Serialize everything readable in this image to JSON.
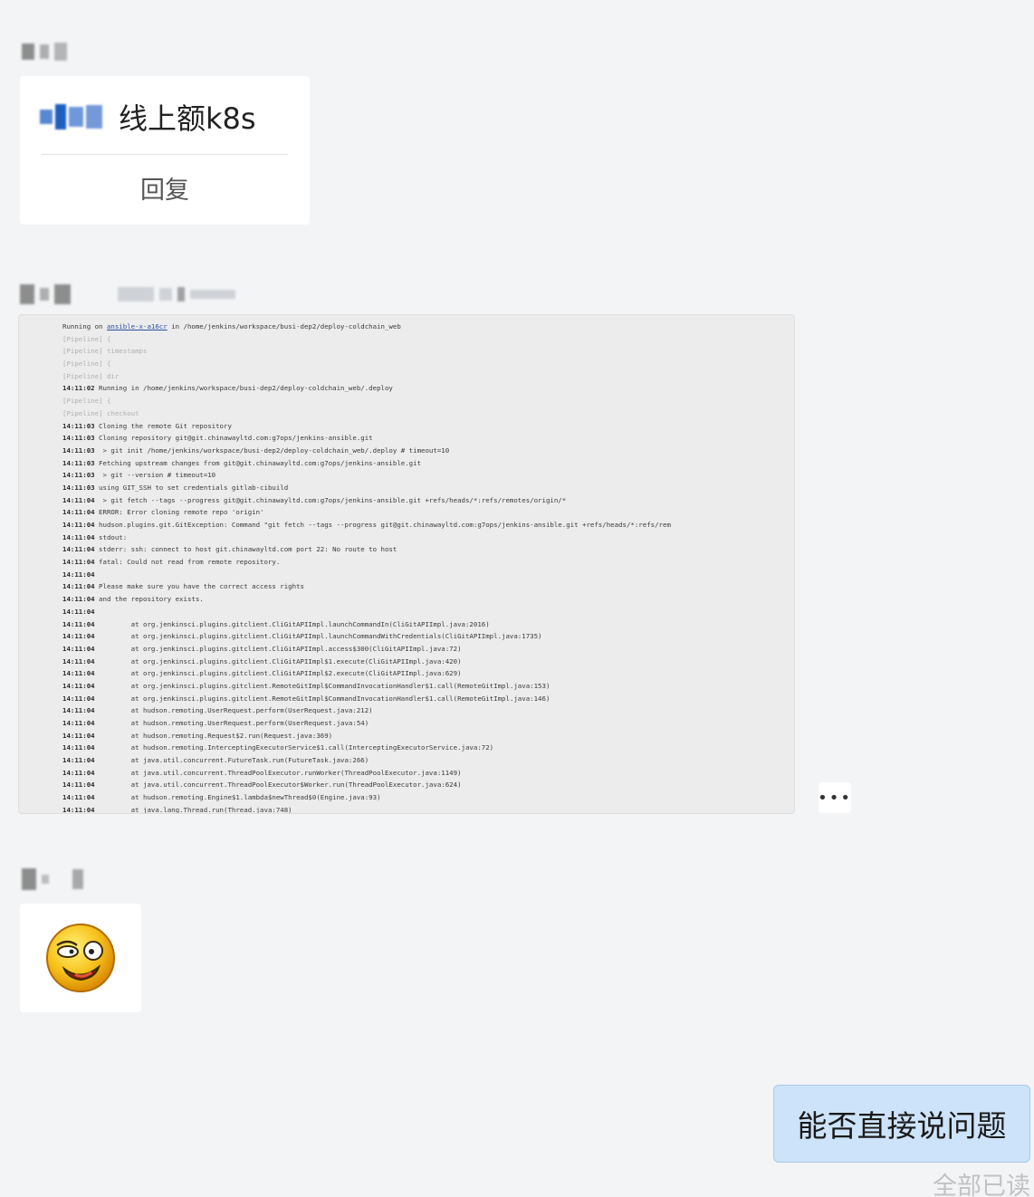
{
  "messages": [
    {
      "type": "reply_card",
      "quote_text": "线上额k8s",
      "reply_label": "回复"
    },
    {
      "type": "log_image",
      "log_lines": [
        {
          "ts": "",
          "text": "Running on ",
          "link": "ansible-x-a16cr",
          "rest": " in /home/jenkins/workspace/busi-dep2/deploy-coldchain_web",
          "dim": false
        },
        {
          "ts": "",
          "text": "[Pipeline] {",
          "dim": true
        },
        {
          "ts": "",
          "text": "[Pipeline] timestamps",
          "dim": true
        },
        {
          "ts": "",
          "text": "[Pipeline] {",
          "dim": true
        },
        {
          "ts": "",
          "text": "[Pipeline] dir",
          "dim": true
        },
        {
          "ts": "14:11:02",
          "text": " Running in /home/jenkins/workspace/busi-dep2/deploy-coldchain_web/.deploy",
          "dim": false
        },
        {
          "ts": "",
          "text": "[Pipeline] {",
          "dim": true
        },
        {
          "ts": "",
          "text": "[Pipeline] checkout",
          "dim": true
        },
        {
          "ts": "14:11:03",
          "text": " Cloning the remote Git repository",
          "dim": false
        },
        {
          "ts": "14:11:03",
          "text": " Cloning repository git@git.chinawayltd.com:g7ops/jenkins-ansible.git",
          "dim": false
        },
        {
          "ts": "14:11:03",
          "text": "  > git init /home/jenkins/workspace/busi-dep2/deploy-coldchain_web/.deploy # timeout=10",
          "dim": false
        },
        {
          "ts": "14:11:03",
          "text": " Fetching upstream changes from git@git.chinawayltd.com:g7ops/jenkins-ansible.git",
          "dim": false
        },
        {
          "ts": "14:11:03",
          "text": "  > git --version # timeout=10",
          "dim": false
        },
        {
          "ts": "14:11:03",
          "text": " using GIT_SSH to set credentials gitlab-cibuild",
          "dim": false
        },
        {
          "ts": "14:11:04",
          "text": "  > git fetch --tags --progress git@git.chinawayltd.com:g7ops/jenkins-ansible.git +refs/heads/*:refs/remotes/origin/*",
          "dim": false
        },
        {
          "ts": "14:11:04",
          "text": " ERROR: Error cloning remote repo 'origin'",
          "dim": false
        },
        {
          "ts": "14:11:04",
          "text": " hudson.plugins.git.GitException: Command \"git fetch --tags --progress git@git.chinawayltd.com:g7ops/jenkins-ansible.git +refs/heads/*:refs/rem",
          "dim": false
        },
        {
          "ts": "14:11:04",
          "text": " stdout:",
          "dim": false
        },
        {
          "ts": "14:11:04",
          "text": " stderr: ssh: connect to host git.chinawayltd.com port 22: No route to host",
          "dim": false
        },
        {
          "ts": "14:11:04",
          "text": " fatal: Could not read from remote repository.",
          "dim": false
        },
        {
          "ts": "14:11:04",
          "text": "",
          "dim": false
        },
        {
          "ts": "14:11:04",
          "text": " Please make sure you have the correct access rights",
          "dim": false
        },
        {
          "ts": "14:11:04",
          "text": " and the repository exists.",
          "dim": false
        },
        {
          "ts": "14:11:04",
          "text": "",
          "dim": false
        },
        {
          "ts": "14:11:04",
          "text": "         at org.jenkinsci.plugins.gitclient.CliGitAPIImpl.launchCommandIn(CliGitAPIImpl.java:2016)",
          "dim": false
        },
        {
          "ts": "14:11:04",
          "text": "         at org.jenkinsci.plugins.gitclient.CliGitAPIImpl.launchCommandWithCredentials(CliGitAPIImpl.java:1735)",
          "dim": false
        },
        {
          "ts": "14:11:04",
          "text": "         at org.jenkinsci.plugins.gitclient.CliGitAPIImpl.access$300(CliGitAPIImpl.java:72)",
          "dim": false
        },
        {
          "ts": "14:11:04",
          "text": "         at org.jenkinsci.plugins.gitclient.CliGitAPIImpl$1.execute(CliGitAPIImpl.java:420)",
          "dim": false
        },
        {
          "ts": "14:11:04",
          "text": "         at org.jenkinsci.plugins.gitclient.CliGitAPIImpl$2.execute(CliGitAPIImpl.java:629)",
          "dim": false
        },
        {
          "ts": "14:11:04",
          "text": "         at org.jenkinsci.plugins.gitclient.RemoteGitImpl$CommandInvocationHandler$1.call(RemoteGitImpl.java:153)",
          "dim": false
        },
        {
          "ts": "14:11:04",
          "text": "         at org.jenkinsci.plugins.gitclient.RemoteGitImpl$CommandInvocationHandler$1.call(RemoteGitImpl.java:146)",
          "dim": false
        },
        {
          "ts": "14:11:04",
          "text": "         at hudson.remoting.UserRequest.perform(UserRequest.java:212)",
          "dim": false
        },
        {
          "ts": "14:11:04",
          "text": "         at hudson.remoting.UserRequest.perform(UserRequest.java:54)",
          "dim": false
        },
        {
          "ts": "14:11:04",
          "text": "         at hudson.remoting.Request$2.run(Request.java:369)",
          "dim": false
        },
        {
          "ts": "14:11:04",
          "text": "         at hudson.remoting.InterceptingExecutorService$1.call(InterceptingExecutorService.java:72)",
          "dim": false
        },
        {
          "ts": "14:11:04",
          "text": "         at java.util.concurrent.FutureTask.run(FutureTask.java:266)",
          "dim": false
        },
        {
          "ts": "14:11:04",
          "text": "         at java.util.concurrent.ThreadPoolExecutor.runWorker(ThreadPoolExecutor.java:1149)",
          "dim": false
        },
        {
          "ts": "14:11:04",
          "text": "         at java.util.concurrent.ThreadPoolExecutor$Worker.run(ThreadPoolExecutor.java:624)",
          "dim": false
        },
        {
          "ts": "14:11:04",
          "text": "         at hudson.remoting.Engine$1.lambda$newThread$0(Engine.java:93)",
          "dim": false
        },
        {
          "ts": "14:11:04",
          "text": "         at java.lang.Thread.run(Thread.java:748)",
          "dim": false
        }
      ],
      "more_label": "•••"
    },
    {
      "type": "sticker",
      "sticker_icon": "dizzy-face-sticker-icon"
    }
  ],
  "outgoing": {
    "text": "能否直接说问题",
    "status": "全部已读"
  },
  "colors": {
    "background": "#f3f4f6",
    "outgoing_bubble": "#cde3f9",
    "read_status": "#c2c2c2"
  }
}
